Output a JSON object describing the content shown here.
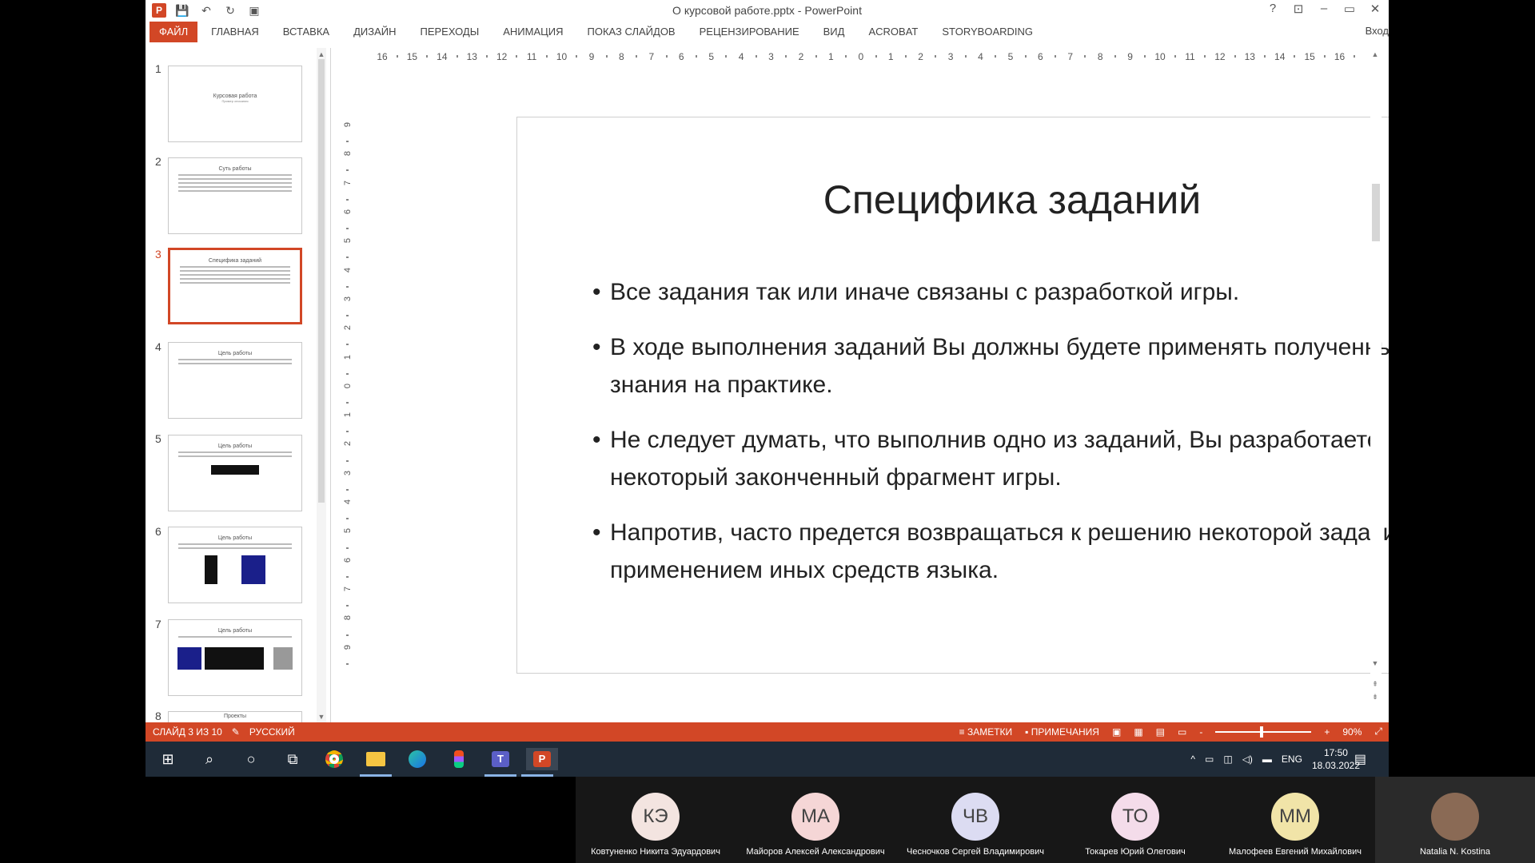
{
  "window": {
    "title": "О курсовой работе.pptx - PowerPoint",
    "help": "?",
    "min": "–",
    "restore": "▭",
    "close": "✕"
  },
  "qat": {
    "save": "💾",
    "undo": "↶",
    "redo": "↻",
    "present": "▣"
  },
  "ribbon": {
    "tabs": [
      "ФАЙЛ",
      "ГЛАВНАЯ",
      "ВСТАВКА",
      "ДИЗАЙН",
      "ПЕРЕХОДЫ",
      "АНИМАЦИЯ",
      "ПОКАЗ СЛАЙДОВ",
      "РЕЦЕНЗИРОВАНИЕ",
      "ВИД",
      "ACROBAT",
      "STORYBOARDING"
    ],
    "signin": "Вход"
  },
  "thumbnails": [
    {
      "num": "1",
      "title": "Курсовая работа",
      "sub": "Пример описания"
    },
    {
      "num": "2",
      "title": "Суть работы",
      "sub": ""
    },
    {
      "num": "3",
      "title": "Специфика заданий",
      "sub": ""
    },
    {
      "num": "4",
      "title": "Цель работы",
      "sub": ""
    },
    {
      "num": "5",
      "title": "Цель работы",
      "sub": ""
    },
    {
      "num": "6",
      "title": "Цель работы",
      "sub": ""
    },
    {
      "num": "7",
      "title": "Цель работы",
      "sub": ""
    },
    {
      "num": "8",
      "title": "Проекты",
      "sub": ""
    }
  ],
  "ruler": {
    "h": [
      "16",
      "15",
      "14",
      "13",
      "12",
      "11",
      "10",
      "9",
      "8",
      "7",
      "6",
      "5",
      "4",
      "3",
      "2",
      "1",
      "0",
      "1",
      "2",
      "3",
      "4",
      "5",
      "6",
      "7",
      "8",
      "9",
      "10",
      "11",
      "12",
      "13",
      "14",
      "15",
      "16"
    ],
    "v": [
      "9",
      "8",
      "7",
      "6",
      "5",
      "4",
      "3",
      "2",
      "1",
      "0",
      "1",
      "2",
      "3",
      "4",
      "5",
      "6",
      "7",
      "8",
      "9"
    ]
  },
  "slide": {
    "title": "Специфика заданий",
    "bullets": [
      "Все задания так или иначе связаны с разработкой игры.",
      "В ходе выполнения заданий Вы должны  будете применять полученные знания на практике.",
      "Не следует думать, что выполнив одно из заданий, Вы разработаете некоторый законченный фрагмент игры.",
      "Напротив, часто предется возвращаться к решению некоторой задачи, но с применением иных средств языка."
    ]
  },
  "status": {
    "slide_counter": "СЛАЙД 3 ИЗ 10",
    "language": "РУССКИЙ",
    "notes": "ЗАМЕТКИ",
    "comments": "ПРИМЕЧАНИЯ",
    "zoom": "90%",
    "zoom_minus": "-",
    "zoom_plus": "+",
    "zoom_level": 0.46
  },
  "taskbar": {
    "lang": "ENG",
    "time": "17:50",
    "date": "18.03.2022"
  },
  "participants": [
    {
      "initials": "КЭ",
      "name": "Ковтуненко Никита Эдуардович",
      "color": "#f3e4e0"
    },
    {
      "initials": "МА",
      "name": "Майоров Алексей Александрович",
      "color": "#f5d6d6"
    },
    {
      "initials": "ЧВ",
      "name": "Чесночков Сергей Владимирович",
      "color": "#dcdcf2"
    },
    {
      "initials": "ТО",
      "name": "Токарев Юрий Олегович",
      "color": "#f4dcea"
    },
    {
      "initials": "ММ",
      "name": "Малофеев Евгений Михайлович",
      "color": "#f1e4a8"
    },
    {
      "initials": "",
      "name": "Natalia N. Kostina",
      "color": "#8a6a55"
    }
  ],
  "colors": {
    "accent": "#d24726",
    "taskbar": "#1f2b38"
  }
}
